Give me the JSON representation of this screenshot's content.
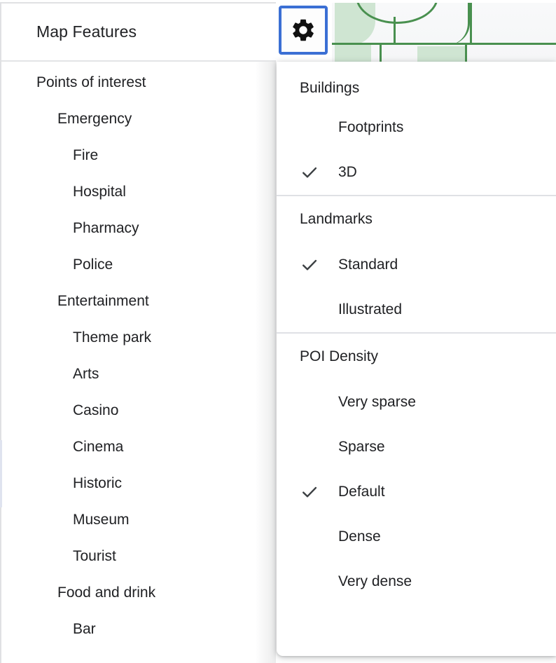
{
  "panel": {
    "title": "Map Features",
    "tree": [
      {
        "label": "Points of interest",
        "level": 0
      },
      {
        "label": "Emergency",
        "level": 1
      },
      {
        "label": "Fire",
        "level": 2
      },
      {
        "label": "Hospital",
        "level": 2
      },
      {
        "label": "Pharmacy",
        "level": 2
      },
      {
        "label": "Police",
        "level": 2
      },
      {
        "label": "Entertainment",
        "level": 1
      },
      {
        "label": "Theme park",
        "level": 2
      },
      {
        "label": "Arts",
        "level": 2
      },
      {
        "label": "Casino",
        "level": 2
      },
      {
        "label": "Cinema",
        "level": 2
      },
      {
        "label": "Historic",
        "level": 2
      },
      {
        "label": "Museum",
        "level": 2
      },
      {
        "label": "Tourist",
        "level": 2
      },
      {
        "label": "Food and drink",
        "level": 1
      },
      {
        "label": "Bar",
        "level": 2
      }
    ]
  },
  "toolbar": {
    "settings_icon": "gear-icon"
  },
  "menu": {
    "sections": [
      {
        "title": "Buildings",
        "options": [
          {
            "label": "Footprints",
            "checked": false
          },
          {
            "label": "3D",
            "checked": true
          }
        ]
      },
      {
        "title": "Landmarks",
        "options": [
          {
            "label": "Standard",
            "checked": true
          },
          {
            "label": "Illustrated",
            "checked": false
          }
        ]
      },
      {
        "title": "POI Density",
        "options": [
          {
            "label": "Very sparse",
            "checked": false
          },
          {
            "label": "Sparse",
            "checked": false
          },
          {
            "label": "Default",
            "checked": true
          },
          {
            "label": "Dense",
            "checked": false
          },
          {
            "label": "Very dense",
            "checked": false
          }
        ]
      }
    ],
    "check_icon": "check-icon"
  },
  "colors": {
    "accent_blue": "#3b6fd4",
    "text_primary": "#202124",
    "check_gray": "#3c4043",
    "divider": "#dfe1e5",
    "map_road_green": "#49904f",
    "map_area_green": "#cfe5d2",
    "map_background": "#f8f9fa"
  }
}
